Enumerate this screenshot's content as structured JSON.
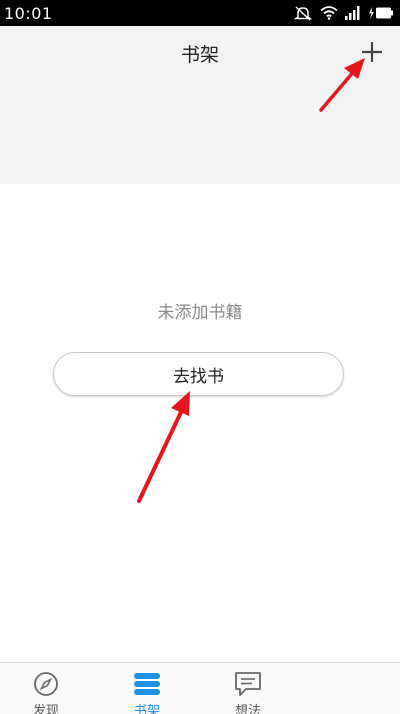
{
  "status_bar": {
    "time": "10:01"
  },
  "header": {
    "title": "书架",
    "add_icon": "plus-icon"
  },
  "content": {
    "empty_text": "未添加书籍",
    "find_book_label": "去找书"
  },
  "bottom_nav": {
    "items": [
      {
        "label": "发现",
        "icon": "compass-icon",
        "active": false
      },
      {
        "label": "书架",
        "icon": "bookshelf-icon",
        "active": true
      },
      {
        "label": "想法",
        "icon": "comment-icon",
        "active": false
      }
    ]
  },
  "colors": {
    "accent": "#1e90e6",
    "header_bg": "#f2f2f2",
    "annotation_arrow": "#e8141c"
  }
}
